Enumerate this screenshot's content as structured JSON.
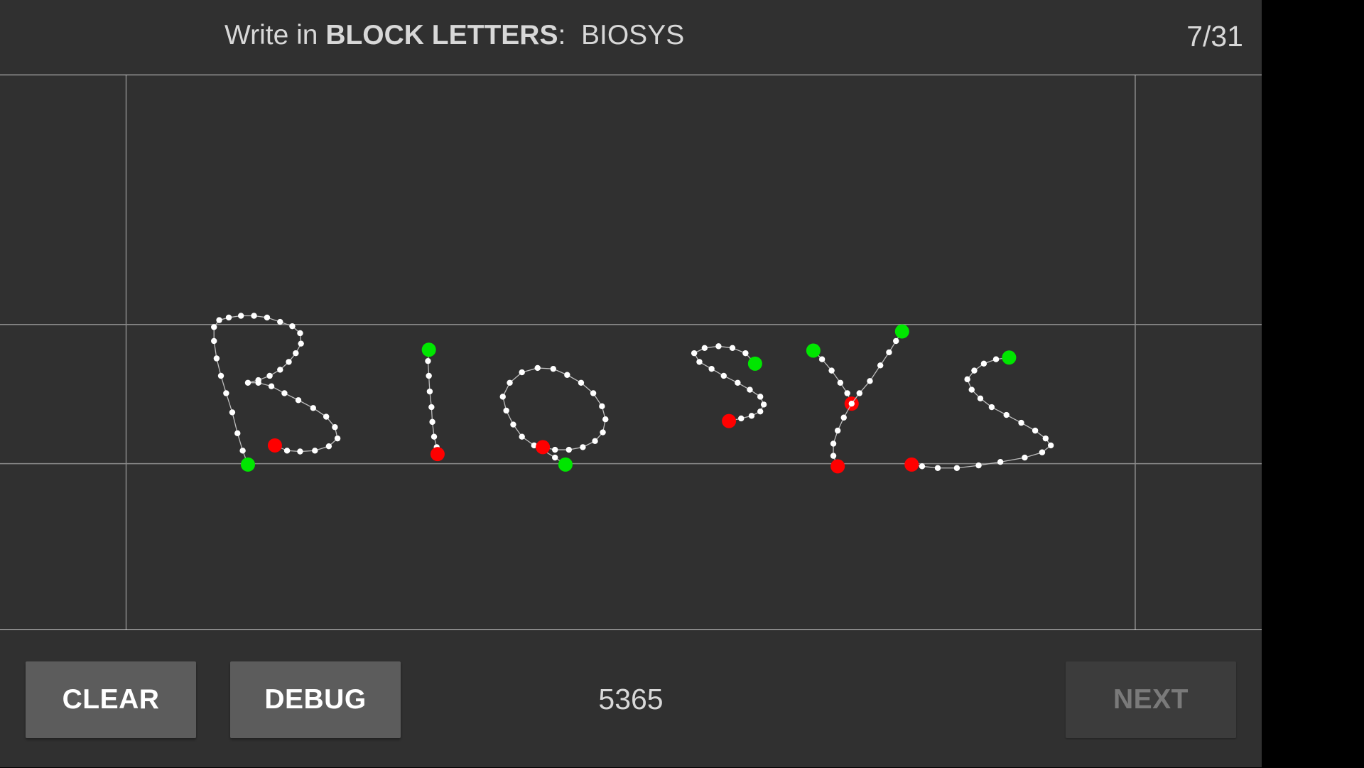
{
  "prompt": {
    "prefix": "Write in ",
    "emphasis": "BLOCK LETTERS",
    "suffix": ":",
    "target_word": "BIOSYS"
  },
  "progress": {
    "text": "7/31",
    "current": 7,
    "total": 31
  },
  "buttons": {
    "clear": "CLEAR",
    "debug": "DEBUG",
    "next": "NEXT",
    "next_enabled": false
  },
  "point_count": "5365",
  "colors": {
    "background": "#303030",
    "ink": "#ffffff",
    "stroke_start": "#00e600",
    "stroke_end": "#ff0000",
    "guide": "#8a8a8a"
  }
}
